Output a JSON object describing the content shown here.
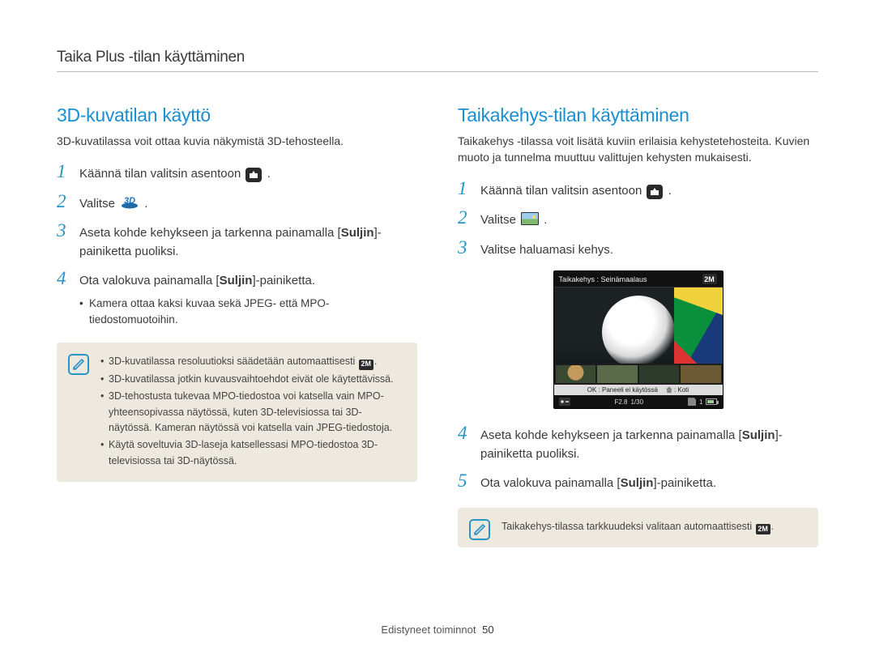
{
  "sectionTitle": "Taika Plus -tilan käyttäminen",
  "left": {
    "heading": "3D-kuvatilan käyttö",
    "intro": "3D-kuvatilassa voit ottaa kuvia näkymistä 3D-tehosteella.",
    "steps": {
      "s1_a": "Käännä tilan valitsin asentoon ",
      "s1_b": ".",
      "s2_a": "Valitse ",
      "s2_b": ".",
      "s3_a": "Aseta kohde kehykseen ja tarkenna painamalla [",
      "s3_bold": "Suljin",
      "s3_b": "]-painiketta puoliksi.",
      "s4_a": "Ota valokuva painamalla [",
      "s4_bold": "Suljin",
      "s4_b": "]-painiketta.",
      "s4_sub": "Kamera ottaa kaksi kuvaa sekä JPEG- että MPO-tiedostomuotoihin."
    },
    "note": {
      "li1_a": "3D-kuvatilassa resoluutioksi säädetään automaattisesti ",
      "li1_b": ".",
      "li2": "3D-kuvatilassa jotkin kuvausvaihtoehdot eivät ole käytettävissä.",
      "li3": "3D-tehostusta tukevaa MPO-tiedostoa voi katsella vain MPO-yhteensopivassa näytössä, kuten 3D-televisiossa tai 3D-näytössä. Kameran näytössä voi katsella vain JPEG-tiedostoja.",
      "li4": "Käytä soveltuvia 3D-laseja katsellessasi MPO-tiedostoa 3D-televisiossa tai 3D-näytössä."
    }
  },
  "right": {
    "heading": "Taikakehys-tilan käyttäminen",
    "intro": "Taikakehys -tilassa voit lisätä kuviin erilaisia kehystetehosteita. Kuvien muoto ja tunnelma muuttuu valittujen kehysten mukaisesti.",
    "steps": {
      "s1_a": "Käännä tilan valitsin asentoon ",
      "s1_b": ".",
      "s2_a": "Valitse ",
      "s2_b": ".",
      "s3": "Valitse haluamasi kehys.",
      "s4_a": "Aseta kohde kehykseen ja tarkenna painamalla [",
      "s4_bold": "Suljin",
      "s4_b": "]-painiketta puoliksi.",
      "s5_a": "Ota valokuva painamalla [",
      "s5_bold": "Suljin",
      "s5_b": "]-painiketta."
    },
    "screenshot": {
      "topTitle": "Taikakehys : Seinämaalaus",
      "okLabel": "OK : Paneeli ei käytössä",
      "homeLabel": ": Koti",
      "fLabel": "F2.8",
      "shutterLabel": "1/30",
      "countLabel": "1"
    },
    "note_a": "Taikakehys-tilassa tarkkuudeksi valitaan automaattisesti ",
    "note_b": "."
  },
  "footer": {
    "label": "Edistyneet toiminnot",
    "page": "50"
  },
  "iconBadge": "2M"
}
